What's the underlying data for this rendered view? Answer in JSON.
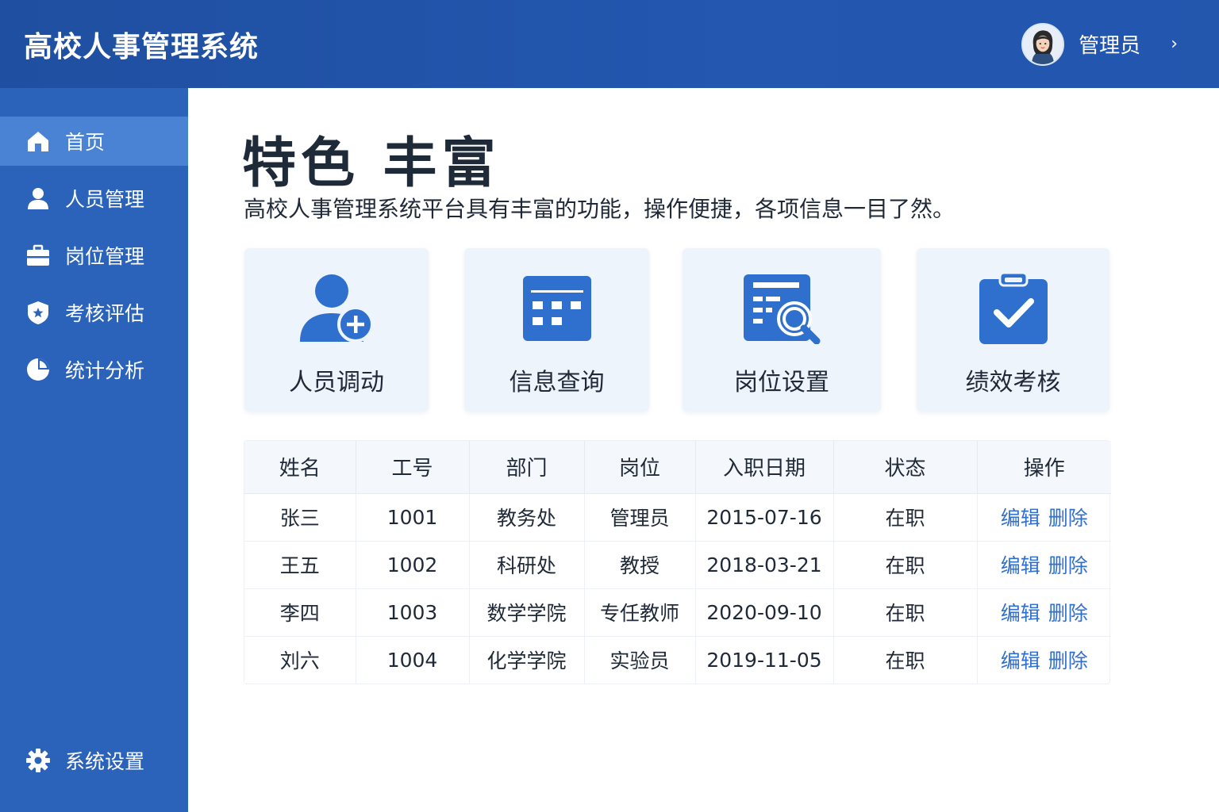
{
  "header": {
    "app_title": "高校人事管理系统",
    "user_name": "管理员",
    "chevron": "›"
  },
  "sidebar": {
    "items": [
      {
        "label": "首页",
        "icon": "home-icon",
        "active": true
      },
      {
        "label": "人员管理",
        "icon": "user-icon",
        "active": false
      },
      {
        "label": "岗位管理",
        "icon": "briefcase-icon",
        "active": false
      },
      {
        "label": "考核评估",
        "icon": "shield-icon",
        "active": false
      },
      {
        "label": "统计分析",
        "icon": "pie-chart-icon",
        "active": false
      }
    ],
    "settings": {
      "label": "系统设置",
      "icon": "gear-icon"
    }
  },
  "main": {
    "title": "特色 丰富",
    "subtitle": "高校人事管理系统平台具有丰富的功能，操作便捷，各项信息一目了然。",
    "cards": [
      {
        "label": "人员调动",
        "icon": "user-add-icon"
      },
      {
        "label": "信息查询",
        "icon": "calendar-grid-icon"
      },
      {
        "label": "岗位设置",
        "icon": "document-search-icon"
      },
      {
        "label": "绩效考核",
        "icon": "clipboard-check-icon"
      }
    ]
  },
  "table": {
    "headers": [
      "姓名",
      "工号",
      "部门",
      "岗位",
      "入职日期",
      "状态",
      "操作"
    ],
    "rows": [
      {
        "name": "张三",
        "id": "1001",
        "dept": "教务处",
        "position": "管理员",
        "date": "2015-07-16",
        "status": "在职"
      },
      {
        "name": "王五",
        "id": "1002",
        "dept": "科研处",
        "position": "教授",
        "date": "2018-03-21",
        "status": "在职"
      },
      {
        "name": "李四",
        "id": "1003",
        "dept": "数学学院",
        "position": "专任教师",
        "date": "2020-09-10",
        "status": "在职"
      },
      {
        "name": "刘六",
        "id": "1004",
        "dept": "化学学院",
        "position": "实验员",
        "date": "2019-11-05",
        "status": "在职"
      }
    ],
    "actions": {
      "edit": "编辑",
      "delete": "删除"
    }
  },
  "colors": {
    "header_bg": "#2357b0",
    "sidebar_bg": "#2b63bb",
    "sidebar_active": "#4a82d4",
    "card_bg": "#eef4fc",
    "icon_blue": "#2f6fce",
    "link_blue": "#2f6fce"
  }
}
